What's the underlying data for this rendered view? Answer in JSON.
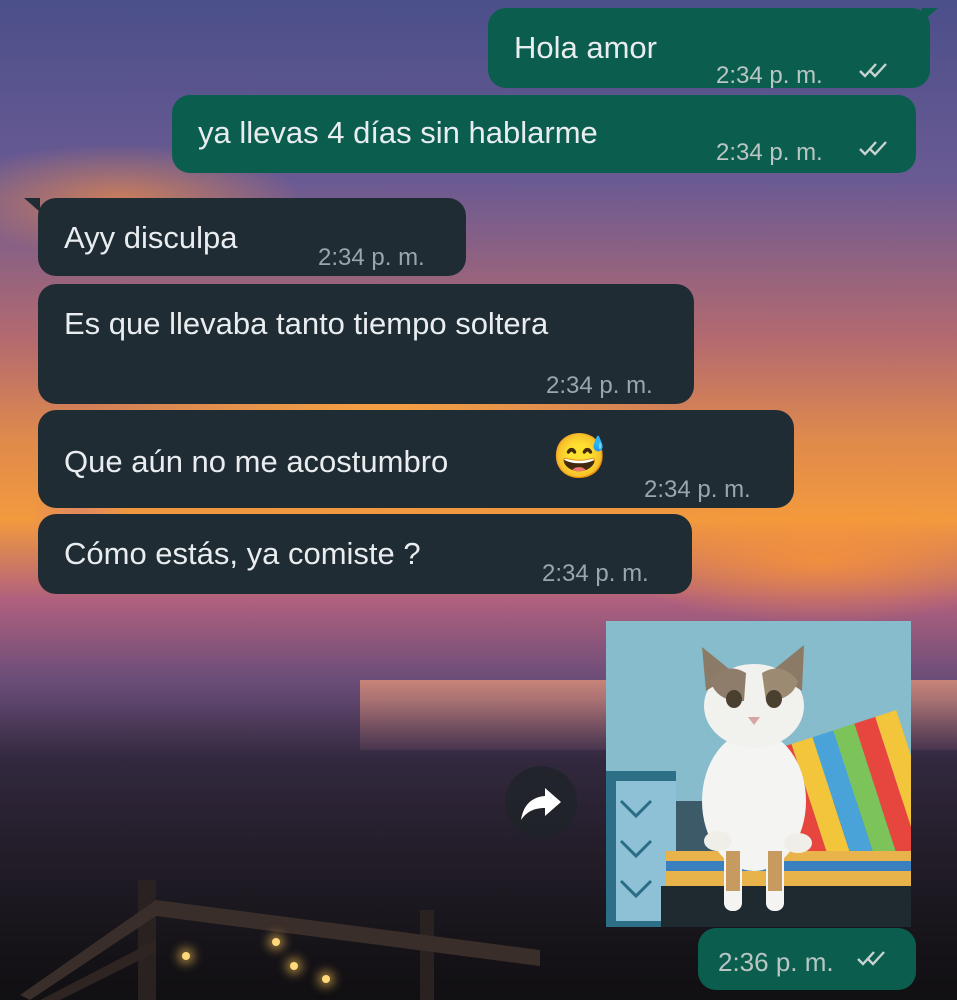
{
  "messages": [
    {
      "direction": "outgoing",
      "text": "Hola amor",
      "time": "2:34 p. m.",
      "status": "read-double-check-icon"
    },
    {
      "direction": "outgoing",
      "text": "ya llevas 4 días sin hablarme",
      "time": "2:34 p. m.",
      "status": "read-double-check-icon"
    },
    {
      "direction": "incoming",
      "text": "Ayy disculpa",
      "time": "2:34 p. m."
    },
    {
      "direction": "incoming",
      "text": "Es que llevaba tanto tiempo soltera",
      "time": "2:34 p. m."
    },
    {
      "direction": "incoming",
      "text": "Que aún no me acostumbro",
      "emoji": "😅",
      "time": "2:34 p. m."
    },
    {
      "direction": "incoming",
      "text": "Cómo estás, ya comiste ?",
      "time": "2:34 p. m."
    },
    {
      "direction": "outgoing",
      "type": "image",
      "image": "cat-sitting-photo",
      "time": "2:36 p. m.",
      "status": "read-double-check-icon"
    }
  ],
  "colors": {
    "outgoing_bubble": "#0b5e4e",
    "incoming_bubble": "#1f2c33",
    "text": "#e9edef",
    "read_ticks": "#c7d3d1"
  },
  "icons": {
    "forward": "forward-arrow-icon"
  }
}
